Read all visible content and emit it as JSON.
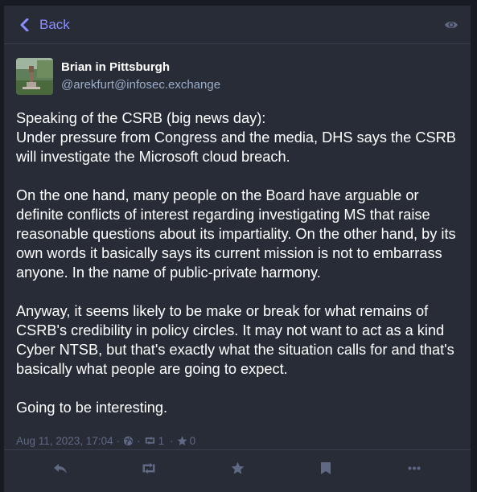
{
  "header": {
    "back_label": "Back"
  },
  "status": {
    "display_name": "Brian in Pittsburgh",
    "handle": "@arekfurt@infosec.exchange",
    "paragraphs": [
      [
        "Speaking of the CSRB (big news day):",
        "Under pressure from Congress and the media, DHS says the CSRB will investigate the Microsoft cloud breach."
      ],
      [
        "On the one hand, many people on the Board have arguable or definite conflicts of interest regarding investigating MS that raise reasonable questions about its impartiality. On the other hand, by its own words it basically says its current mission is not to embarrass anyone. In the name of public-private harmony."
      ],
      [
        "Anyway, it seems likely to be make or break for what remains of CSRB's credibility in policy circles. It may not want to act as a kind Cyber NTSB, but that's exactly what the situation calls for and that's basically what people are going to expect."
      ],
      [
        "Going to be interesting."
      ]
    ],
    "timestamp": "Aug 11, 2023, 17:04",
    "separator": "·",
    "boost_count": "1",
    "favourite_count": "0"
  },
  "colors": {
    "background": "#191b22",
    "panel": "#282c37",
    "accent": "#8c8dff",
    "muted": "#606984",
    "handle": "#9baec8"
  },
  "icons": [
    "chevron-left-icon",
    "eye-icon",
    "globe-icon",
    "retweet-icon",
    "star-icon",
    "reply-icon",
    "bookmark-icon",
    "ellipsis-icon"
  ]
}
